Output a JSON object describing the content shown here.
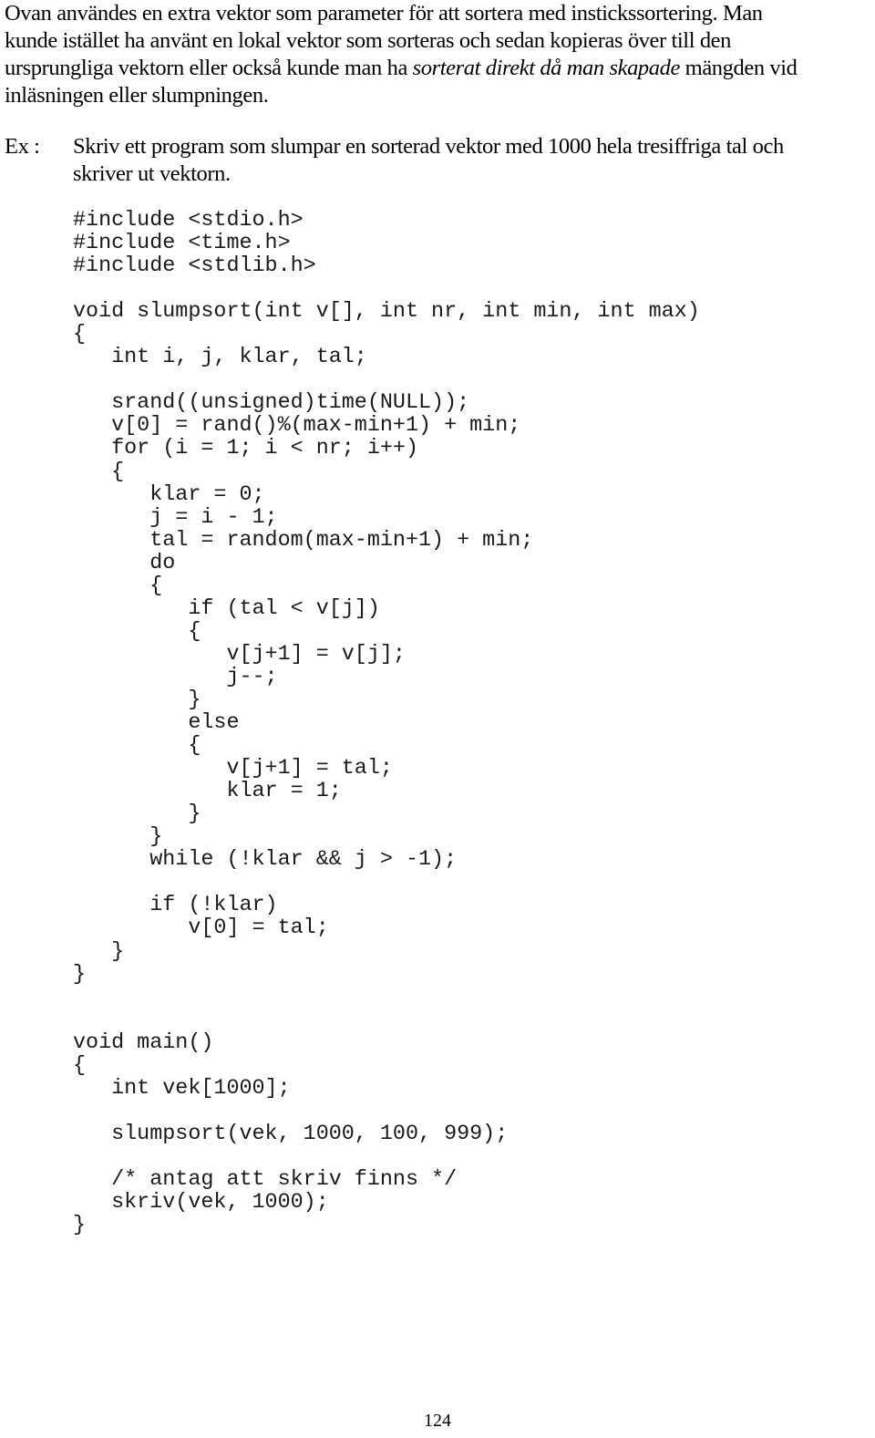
{
  "intro": {
    "lines": [
      "Ovan användes en extra vektor som parameter för att sortera med instickssortering. Man",
      "kunde istället ha använt en lokal vektor som sorteras och sedan kopieras över till den"
    ],
    "line3_before": "ursprungliga vektorn eller också kunde man ha ",
    "line3_italic": "sorterat direkt då man skapade",
    "line3_after": " mängden vid",
    "line4": "inläsningen eller slumpningen."
  },
  "example": {
    "label": "Ex :",
    "text_line1": "Skriv ett program som slumpar en sorterad vektor med 1000 hela tresiffriga tal och",
    "text_line2": "skriver ut vektorn."
  },
  "code_lines": [
    "#include <stdio.h>",
    "#include <time.h>",
    "#include <stdlib.h>",
    "",
    "void slumpsort(int v[], int nr, int min, int max)",
    "{",
    "   int i, j, klar, tal;",
    "",
    "   srand((unsigned)time(NULL));",
    "   v[0] = rand()%(max-min+1) + min;",
    "   for (i = 1; i < nr; i++)",
    "   {",
    "      klar = 0;",
    "      j = i - 1;",
    "      tal = random(max-min+1) + min;",
    "      do",
    "      {",
    "         if (tal < v[j])",
    "         {",
    "            v[j+1] = v[j];",
    "            j--;",
    "         }",
    "         else",
    "         {",
    "            v[j+1] = tal;",
    "            klar = 1;",
    "         }",
    "      }",
    "      while (!klar && j > -1);",
    "",
    "      if (!klar)",
    "         v[0] = tal;",
    "   }",
    "}",
    "",
    "",
    "void main()",
    "{",
    "   int vek[1000];",
    "",
    "   slumpsort(vek, 1000, 100, 999);",
    "",
    "   /* antag att skriv finns */",
    "   skriv(vek, 1000);",
    "}"
  ],
  "page_number": "124"
}
